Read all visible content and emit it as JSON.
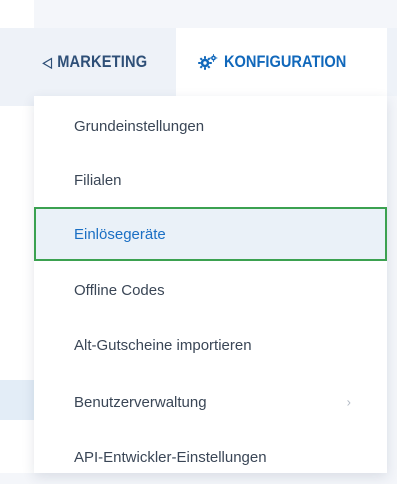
{
  "nav": {
    "tabs": [
      {
        "label": "MARKETING",
        "icon": "megaphone-icon"
      },
      {
        "label": "KONFIGURATION",
        "icon": "gears-icon",
        "active": true
      }
    ]
  },
  "dropdown": {
    "items": [
      {
        "label": "Grundeinstellungen"
      },
      {
        "label": "Filialen"
      },
      {
        "label": "Einlösegeräte",
        "highlighted": true
      },
      {
        "label": "Offline Codes"
      },
      {
        "label": "Alt-Gutscheine importieren"
      },
      {
        "label": "Benutzerverwaltung",
        "has_submenu": true,
        "chevron": "›"
      },
      {
        "label": "API-Entwickler-Einstellungen"
      }
    ]
  },
  "colors": {
    "active_tab_text": "#1168bb",
    "tab_text": "#2e4f77",
    "highlight_border": "#3ba150",
    "highlight_bg": "#eaf1f8"
  }
}
